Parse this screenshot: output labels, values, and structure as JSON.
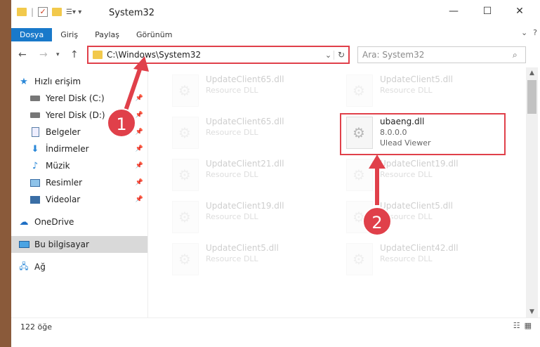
{
  "window": {
    "title": "System32"
  },
  "ribbon": {
    "tabs": [
      "Dosya",
      "Giriş",
      "Paylaş",
      "Görünüm"
    ]
  },
  "address": {
    "path": "C:\\Windows\\System32"
  },
  "search": {
    "placeholder": "Ara: System32"
  },
  "sidebar": {
    "items": [
      {
        "label": "Hızlı erişim",
        "icon": "star-icon",
        "pinned": false
      },
      {
        "label": "Yerel Disk (C:)",
        "icon": "disk-icon",
        "pinned": true
      },
      {
        "label": "Yerel Disk (D:)",
        "icon": "disk-icon",
        "pinned": true
      },
      {
        "label": "Belgeler",
        "icon": "document-icon",
        "pinned": true
      },
      {
        "label": "İndirmeler",
        "icon": "download-icon",
        "pinned": true
      },
      {
        "label": "Müzik",
        "icon": "music-icon",
        "pinned": true
      },
      {
        "label": "Resimler",
        "icon": "picture-icon",
        "pinned": true
      },
      {
        "label": "Videolar",
        "icon": "video-icon",
        "pinned": true
      },
      {
        "label": "OneDrive",
        "icon": "cloud-icon",
        "pinned": false
      },
      {
        "label": "Bu bilgisayar",
        "icon": "computer-icon",
        "pinned": false,
        "selected": true
      },
      {
        "label": "Ağ",
        "icon": "network-icon",
        "pinned": false
      }
    ]
  },
  "files": [
    {
      "name": "UpdateClient65.dll",
      "type": "Resource DLL"
    },
    {
      "name": "UpdateClient5.dll",
      "type": "Resource DLL"
    },
    {
      "name": "UpdateClient65.dll",
      "type": "Resource DLL"
    },
    {
      "name": "ubaeng.dll",
      "version": "8.0.0.0",
      "type": "Ulead Viewer"
    },
    {
      "name": "UpdateClient21.dll",
      "type": "Resource DLL"
    },
    {
      "name": "UpdateClient19.dll",
      "type": "Resource DLL"
    },
    {
      "name": "UpdateClient19.dll",
      "type": "Resource DLL"
    },
    {
      "name": "UpdateClient5.dll",
      "type": "Resource DLL"
    },
    {
      "name": "UpdateClient5.dll",
      "type": "Resource DLL"
    },
    {
      "name": "UpdateClient42.dll",
      "type": "Resource DLL"
    }
  ],
  "status": {
    "count": "122 öğe"
  },
  "annotations": {
    "badge1": "1",
    "badge2": "2"
  }
}
